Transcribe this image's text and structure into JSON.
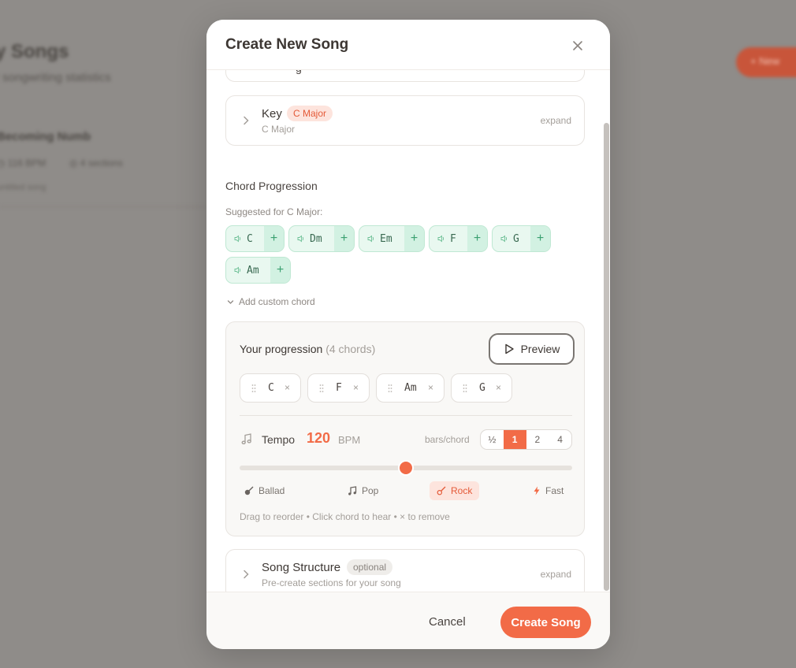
{
  "background": {
    "title": "y Songs",
    "subtitle": "r songwriting statistics",
    "song_name": "Becoming Numb",
    "song_tempo": "◷ 116 BPM",
    "song_sections": "◎ 4 sections",
    "song_note": "untitled song",
    "new_button": "+ New"
  },
  "modal": {
    "title": "Create New Song",
    "peek_text": "g",
    "key_card": {
      "title": "Key",
      "badge": "C Major",
      "subtitle": "C Major",
      "expand": "expand"
    },
    "chords": {
      "section_label": "Chord Progression",
      "suggested_label": "Suggested for C Major:",
      "suggested": [
        "C",
        "Dm",
        "Em",
        "F",
        "G",
        "Am"
      ],
      "add_plus": "+",
      "add_custom": "Add custom chord"
    },
    "progression": {
      "title": "Your progression",
      "count": "(4 chords)",
      "preview": "Preview",
      "chords": [
        "C",
        "F",
        "Am",
        "G"
      ],
      "remove": "×",
      "tempo_label": "Tempo",
      "tempo_value": "120",
      "tempo_unit": "BPM",
      "bars_label": "bars/chord",
      "bars_options": [
        "½",
        "1",
        "2",
        "4"
      ],
      "bars_selected": "1",
      "tempo_fraction": 0.5,
      "presets": [
        "Ballad",
        "Pop",
        "Rock",
        "Fast"
      ],
      "preset_selected": "Rock",
      "hint": "Drag to reorder • Click chord to hear • × to remove"
    },
    "structure_card": {
      "title": "Song Structure",
      "badge": "optional",
      "subtitle": "Pre-create sections for your song",
      "expand": "expand"
    },
    "footer": {
      "cancel": "Cancel",
      "create": "Create Song"
    }
  },
  "colors": {
    "accent": "#f26b47",
    "chip_bg": "#e9f8f0",
    "chip_border": "#bfe8d3",
    "overlay": "#8f8c89"
  }
}
